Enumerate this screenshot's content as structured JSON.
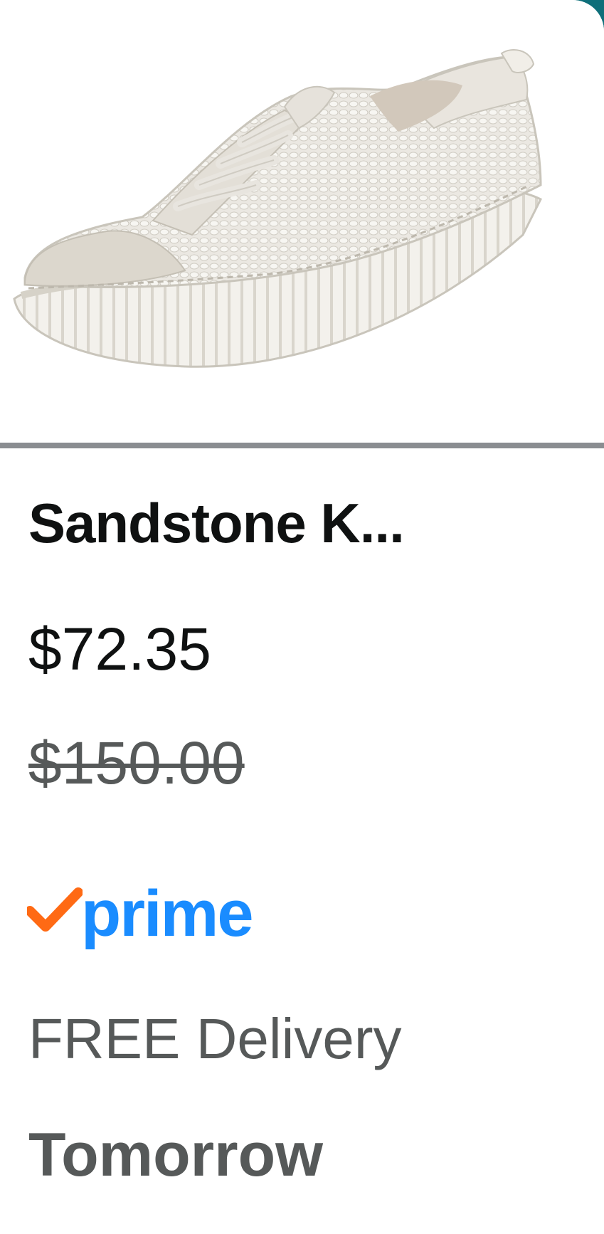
{
  "product": {
    "image_alt": "White knit platform sneaker",
    "title": "Sandstone K...",
    "price": "$72.35",
    "list_price": "$150.00",
    "prime_label": "prime",
    "delivery_label": "FREE Delivery",
    "delivery_date": "Tomorrow"
  },
  "colors": {
    "prime_blue": "#1a8cff",
    "prime_check_orange": "#ff6a14",
    "accent_teal": "#0e6f7a",
    "divider_gray": "#8a8d91",
    "text_dark": "#0f1111",
    "text_gray": "#565959"
  }
}
